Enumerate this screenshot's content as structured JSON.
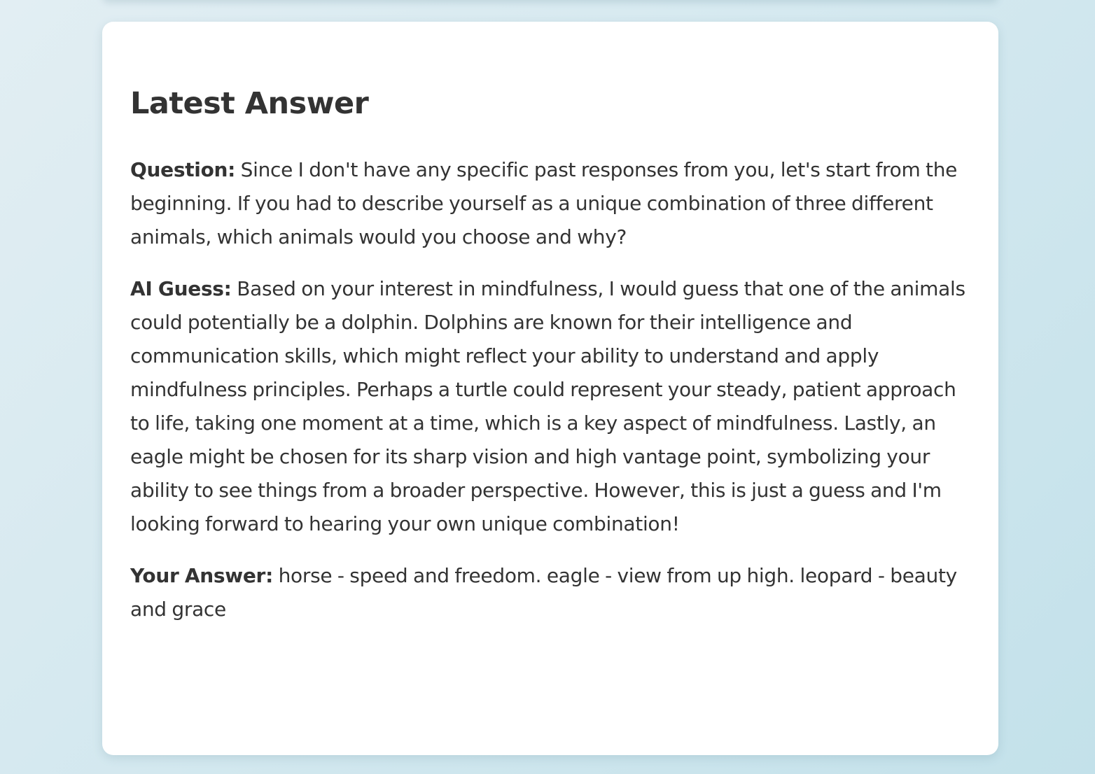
{
  "card": {
    "title": "Latest Answer",
    "question": {
      "label": "Question:",
      "text": "Since I don't have any specific past responses from you, let's start from the beginning. If you had to describe yourself as a unique combination of three different animals, which animals would you choose and why?"
    },
    "ai_guess": {
      "label": "AI Guess:",
      "text": "Based on your interest in mindfulness, I would guess that one of the animals could potentially be a dolphin. Dolphins are known for their intelligence and communication skills, which might reflect your ability to understand and apply mindfulness principles. Perhaps a turtle could represent your steady, patient approach to life, taking one moment at a time, which is a key aspect of mindfulness. Lastly, an eagle might be chosen for its sharp vision and high vantage point, symbolizing your ability to see things from a broader perspective. However, this is just a guess and I'm looking forward to hearing your own unique combination!"
    },
    "your_answer": {
      "label": "Your Answer:",
      "text": "horse - speed and freedom. eagle - view from up high. leopard - beauty and grace"
    }
  },
  "colors": {
    "background_start": "#e2eef3",
    "background_end": "#c3e1ea",
    "card_background": "#ffffff",
    "text": "#333333"
  }
}
